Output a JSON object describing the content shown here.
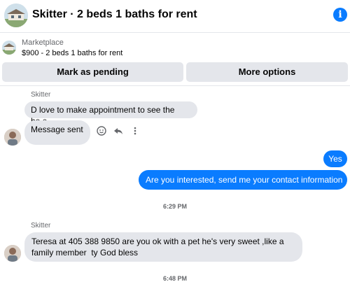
{
  "header": {
    "title": "Skitter · 2 beds 1 baths for rent",
    "info_icon": "info-icon"
  },
  "listing": {
    "source": "Marketplace",
    "price_title": "$900 - 2 beds 1 baths for rent"
  },
  "buttons": {
    "mark_pending": "Mark as pending",
    "more_options": "More options"
  },
  "messages": [
    {
      "sender": "Skitter",
      "text": "D love to make appointment to see the ho.e"
    },
    {
      "text": "Message sent"
    },
    {
      "text": "Yes"
    },
    {
      "text": "Are you interested, send me your contact information"
    },
    {
      "text": "Teresa at 405 388 9850 are you ok with a pet he's very sweet ,like a",
      "text2": "family member  ty God bless",
      "sender": "Skitter"
    }
  ],
  "timestamps": [
    "6:29 PM",
    "6:48 PM"
  ],
  "colors": {
    "accent": "#0a7cff",
    "incoming_bubble": "#e4e6eb",
    "secondary_text": "#65676b"
  },
  "icons": [
    "react-icon",
    "reply-icon",
    "more-icon"
  ]
}
